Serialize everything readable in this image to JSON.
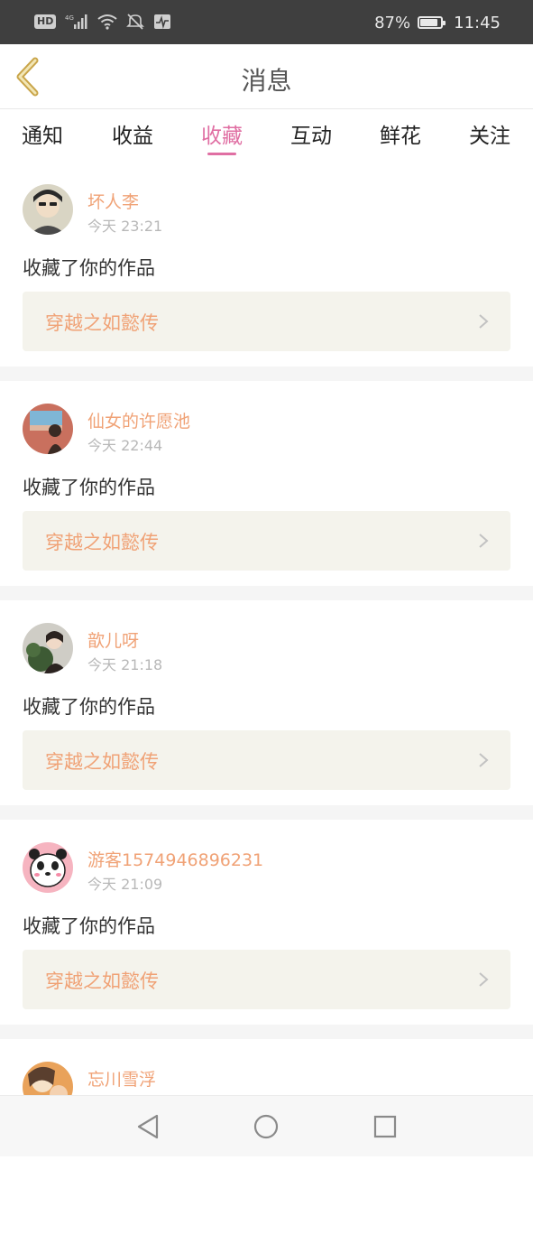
{
  "status_bar": {
    "hd_label": "HD",
    "network_label": "4G",
    "battery_percent": "87%",
    "battery_level": 0.87,
    "time": "11:45"
  },
  "header": {
    "title": "消息",
    "back_icon": "chevron-left-icon"
  },
  "tabs": [
    {
      "label": "通知",
      "active": false
    },
    {
      "label": "收益",
      "active": false
    },
    {
      "label": "收藏",
      "active": true
    },
    {
      "label": "互动",
      "active": false
    },
    {
      "label": "鲜花",
      "active": false
    },
    {
      "label": "关注",
      "active": false
    }
  ],
  "colors": {
    "accent_pink": "#e06fa3",
    "username_orange": "#f0a276",
    "card_link_bg": "#f4f3ec"
  },
  "messages": [
    {
      "username": "坏人李",
      "time": "今天 23:21",
      "action": "收藏了你的作品",
      "work_title": "穿越之如懿传"
    },
    {
      "username": "仙女的许愿池",
      "time": "今天 22:44",
      "action": "收藏了你的作品",
      "work_title": "穿越之如懿传"
    },
    {
      "username": "歆儿呀",
      "time": "今天 21:18",
      "action": "收藏了你的作品",
      "work_title": "穿越之如懿传"
    },
    {
      "username": "游客1574946896231",
      "time": "今天 21:09",
      "action": "收藏了你的作品",
      "work_title": "穿越之如懿传"
    },
    {
      "username": "忘川雪浮"
    }
  ],
  "bottom_nav": {
    "back": "triangle-back-icon",
    "home": "circle-home-icon",
    "recent": "square-recents-icon"
  }
}
